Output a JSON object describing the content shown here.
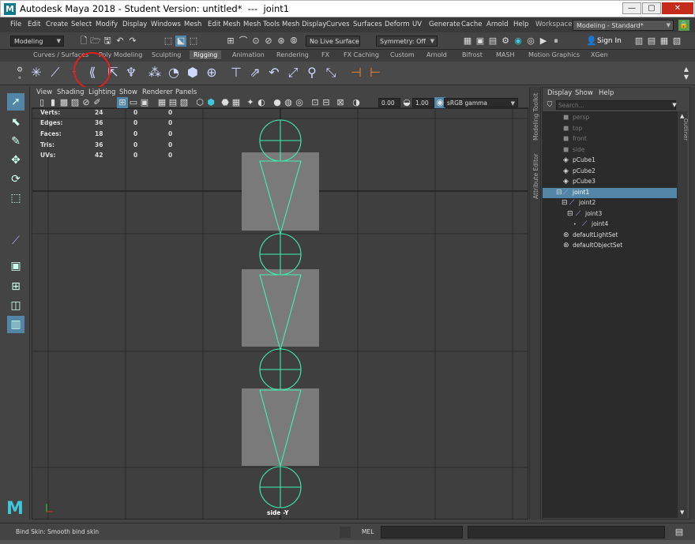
{
  "window": {
    "title": "Autodesk Maya 2018 - Student Version: untitled*  ---  joint1",
    "logo": "M"
  },
  "menus": [
    "File",
    "Edit",
    "Create",
    "Select",
    "Modify",
    "Display",
    "Windows",
    "Mesh",
    "Edit Mesh",
    "Mesh Tools",
    "Mesh Display",
    "Curves",
    "Surfaces",
    "Deform",
    "UV",
    "Generate",
    "Cache",
    "Arnold",
    "Help"
  ],
  "workspace": {
    "label": "Workspace :",
    "value": "Modeling - Standard*"
  },
  "status": {
    "menuset": "Modeling",
    "live_surface": "No Live Surface",
    "symmetry": "Symmetry: Off",
    "sign_in": "Sign In"
  },
  "shelf_tabs": [
    "Curves / Surfaces",
    "Poly Modeling",
    "Sculpting",
    "Rigging",
    "Animation",
    "Rendering",
    "FX",
    "FX Caching",
    "Custom",
    "Arnold",
    "Bifrost",
    "MASH",
    "Motion Graphics",
    "XGen"
  ],
  "active_shelf_tab": "Rigging",
  "shelf_icons": [
    "joint-tool-icon",
    "ik-handle-icon",
    "bind-skin-icon",
    "create-skeleton-icon",
    "humanik-icon",
    "cluster-icon",
    "lattice-icon",
    "wrap-icon",
    "sculpt-icon",
    "constraint-point-icon",
    "constraint-aim-icon",
    "constraint-orient-icon",
    "constraint-scale-icon",
    "constraint-parent-icon",
    "constraint-pole-icon",
    "skin-weights-icon",
    "mirror-icon"
  ],
  "panel_menus": [
    "View",
    "Shading",
    "Lighting",
    "Show",
    "Renderer",
    "Panels"
  ],
  "panel_toolbar": {
    "exposure": "0.00",
    "gamma": "1.00",
    "color_space": "sRGB gamma"
  },
  "hud": {
    "rows": [
      {
        "label": "Verts:",
        "a": "24",
        "b": "0",
        "c": "0"
      },
      {
        "label": "Edges:",
        "a": "36",
        "b": "0",
        "c": "0"
      },
      {
        "label": "Faces:",
        "a": "18",
        "b": "0",
        "c": "0"
      },
      {
        "label": "Tris:",
        "a": "36",
        "b": "0",
        "c": "0"
      },
      {
        "label": "UVs:",
        "a": "42",
        "b": "0",
        "c": "0"
      }
    ],
    "camera": "side -Y"
  },
  "side_tabs": [
    "Modeling Toolkit",
    "Attribute Editor"
  ],
  "outliner": {
    "title_tab": "Outliner",
    "menus": [
      "Display",
      "Show",
      "Help"
    ],
    "search_placeholder": "Search...",
    "items": [
      {
        "label": "persp",
        "dim": true,
        "indent": 0
      },
      {
        "label": "top",
        "dim": true,
        "indent": 0
      },
      {
        "label": "front",
        "dim": true,
        "indent": 0
      },
      {
        "label": "side",
        "dim": true,
        "indent": 0
      },
      {
        "label": "pCube1",
        "dim": false,
        "indent": 0
      },
      {
        "label": "pCube2",
        "dim": false,
        "indent": 0
      },
      {
        "label": "pCube3",
        "dim": false,
        "indent": 0
      },
      {
        "label": "joint1",
        "dim": false,
        "indent": 0,
        "selected": true
      },
      {
        "label": "joint2",
        "dim": false,
        "indent": 1
      },
      {
        "label": "joint3",
        "dim": false,
        "indent": 2
      },
      {
        "label": "joint4",
        "dim": false,
        "indent": 3
      },
      {
        "label": "defaultLightSet",
        "dim": false,
        "indent": 0
      },
      {
        "label": "defaultObjectSet",
        "dim": false,
        "indent": 0
      }
    ]
  },
  "help_line": "Bind Skin: Smooth bind skin",
  "command_line": {
    "label": "MEL"
  },
  "colors": {
    "joint": "#3ff0b0",
    "cube": "#7a7a7a",
    "selection": "#5285a6",
    "highlight_circle": "#e21f1f"
  }
}
